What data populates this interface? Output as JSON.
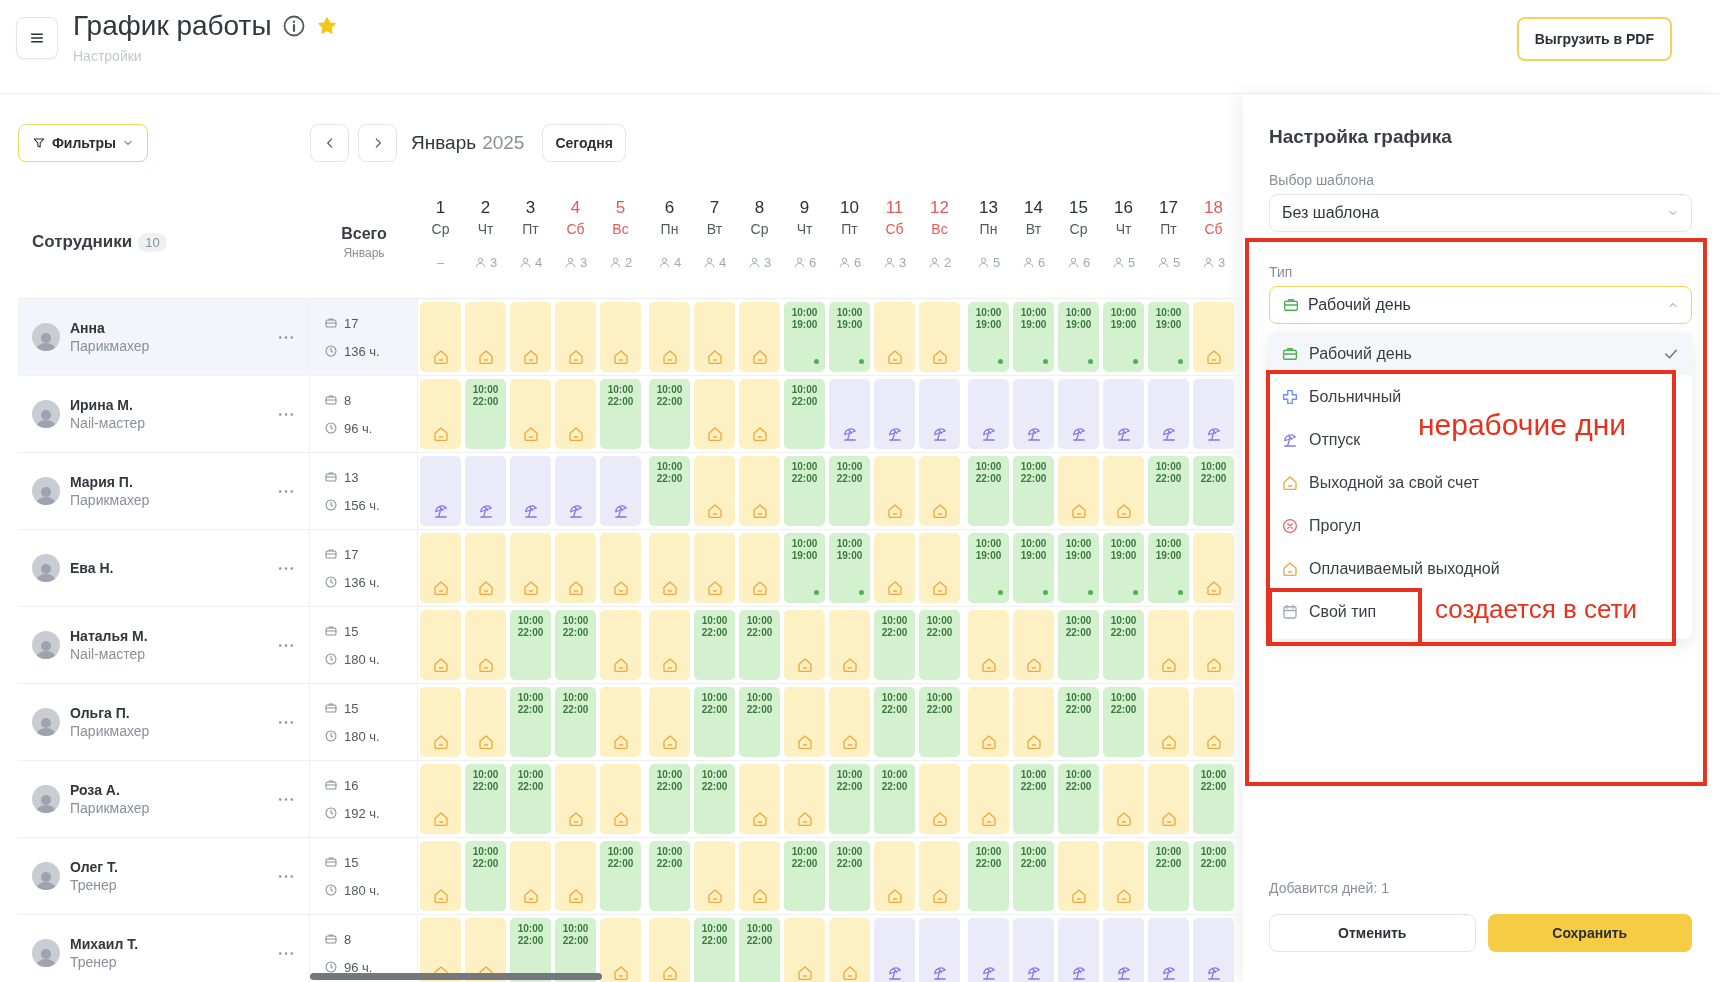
{
  "header": {
    "title": "График работы",
    "subtitle": "Настройки",
    "export_button": "Выгрузить в PDF",
    "favorite": true
  },
  "toolbar": {
    "filters": "Фильтры",
    "month": "Январь",
    "year": "2025",
    "today": "Сегодня"
  },
  "table": {
    "employees_label": "Сотрудники",
    "employees_count": "10",
    "total_label": "Всего",
    "total_sublabel": "Январь",
    "days": [
      {
        "day": "1",
        "weekday": "Ср",
        "weekend": false,
        "staff": "–",
        "staff_icon": false
      },
      {
        "day": "2",
        "weekday": "Чт",
        "weekend": false,
        "staff": "3",
        "staff_icon": true
      },
      {
        "day": "3",
        "weekday": "Пт",
        "weekend": false,
        "staff": "4",
        "staff_icon": true
      },
      {
        "day": "4",
        "weekday": "Сб",
        "weekend": true,
        "staff": "3",
        "staff_icon": true
      },
      {
        "day": "5",
        "weekday": "Вс",
        "weekend": true,
        "staff": "2",
        "staff_icon": true
      },
      {
        "day": "6",
        "weekday": "Пн",
        "weekend": false,
        "staff": "4",
        "staff_icon": true
      },
      {
        "day": "7",
        "weekday": "Вт",
        "weekend": false,
        "staff": "4",
        "staff_icon": true
      },
      {
        "day": "8",
        "weekday": "Ср",
        "weekend": false,
        "staff": "3",
        "staff_icon": true
      },
      {
        "day": "9",
        "weekday": "Чт",
        "weekend": false,
        "staff": "6",
        "staff_icon": true
      },
      {
        "day": "10",
        "weekday": "Пт",
        "weekend": false,
        "staff": "6",
        "staff_icon": true
      },
      {
        "day": "11",
        "weekday": "Сб",
        "weekend": true,
        "staff": "3",
        "staff_icon": true
      },
      {
        "day": "12",
        "weekday": "Вс",
        "weekend": true,
        "staff": "2",
        "staff_icon": true
      },
      {
        "day": "13",
        "weekday": "Пн",
        "weekend": false,
        "staff": "5",
        "staff_icon": true
      },
      {
        "day": "14",
        "weekday": "Вт",
        "weekend": false,
        "staff": "6",
        "staff_icon": true
      },
      {
        "day": "15",
        "weekday": "Ср",
        "weekend": false,
        "staff": "6",
        "staff_icon": true
      },
      {
        "day": "16",
        "weekday": "Чт",
        "weekend": false,
        "staff": "5",
        "staff_icon": true
      },
      {
        "day": "17",
        "weekday": "Пт",
        "weekend": false,
        "staff": "5",
        "staff_icon": true
      },
      {
        "day": "18",
        "weekday": "Сб",
        "weekend": true,
        "staff": "3",
        "staff_icon": true
      }
    ],
    "rows": [
      {
        "name": "Анна",
        "role": "Парикмахер",
        "selected": true,
        "days_count": "17",
        "hours": "136 ч.",
        "cells": [
          {
            "kind": "off"
          },
          {
            "kind": "off"
          },
          {
            "kind": "off"
          },
          {
            "kind": "off"
          },
          {
            "kind": "off"
          },
          {
            "kind": "off"
          },
          {
            "kind": "off"
          },
          {
            "kind": "off"
          },
          {
            "kind": "work",
            "start": "10:00",
            "end": "19:00",
            "dot": true
          },
          {
            "kind": "work",
            "start": "10:00",
            "end": "19:00",
            "dot": true
          },
          {
            "kind": "off"
          },
          {
            "kind": "off"
          },
          {
            "kind": "work",
            "start": "10:00",
            "end": "19:00",
            "dot": true
          },
          {
            "kind": "work",
            "start": "10:00",
            "end": "19:00",
            "dot": true
          },
          {
            "kind": "work",
            "start": "10:00",
            "end": "19:00",
            "dot": true
          },
          {
            "kind": "work",
            "start": "10:00",
            "end": "19:00",
            "dot": true
          },
          {
            "kind": "work",
            "start": "10:00",
            "end": "19:00",
            "dot": true
          },
          {
            "kind": "off"
          }
        ]
      },
      {
        "name": "Ирина М.",
        "role": "Nail-мастер",
        "selected": false,
        "days_count": "8",
        "hours": "96 ч.",
        "cells": [
          {
            "kind": "off"
          },
          {
            "kind": "work",
            "start": "10:00",
            "end": "22:00",
            "dot": false
          },
          {
            "kind": "off"
          },
          {
            "kind": "off"
          },
          {
            "kind": "work",
            "start": "10:00",
            "end": "22:00",
            "dot": false
          },
          {
            "kind": "work",
            "start": "10:00",
            "end": "22:00",
            "dot": false
          },
          {
            "kind": "off"
          },
          {
            "kind": "off"
          },
          {
            "kind": "work",
            "start": "10:00",
            "end": "22:00",
            "dot": false
          },
          {
            "kind": "vacation"
          },
          {
            "kind": "vacation"
          },
          {
            "kind": "vacation"
          },
          {
            "kind": "vacation"
          },
          {
            "kind": "vacation"
          },
          {
            "kind": "vacation"
          },
          {
            "kind": "vacation"
          },
          {
            "kind": "vacation"
          },
          {
            "kind": "vacation"
          }
        ]
      },
      {
        "name": "Мария П.",
        "role": "Парикмахер",
        "selected": false,
        "days_count": "13",
        "hours": "156 ч.",
        "cells": [
          {
            "kind": "vacation"
          },
          {
            "kind": "vacation"
          },
          {
            "kind": "vacation"
          },
          {
            "kind": "vacation"
          },
          {
            "kind": "vacation"
          },
          {
            "kind": "work",
            "start": "10:00",
            "end": "22:00",
            "dot": false
          },
          {
            "kind": "off"
          },
          {
            "kind": "off"
          },
          {
            "kind": "work",
            "start": "10:00",
            "end": "22:00",
            "dot": false
          },
          {
            "kind": "work",
            "start": "10:00",
            "end": "22:00",
            "dot": false
          },
          {
            "kind": "off"
          },
          {
            "kind": "off"
          },
          {
            "kind": "work",
            "start": "10:00",
            "end": "22:00",
            "dot": false
          },
          {
            "kind": "work",
            "start": "10:00",
            "end": "22:00",
            "dot": false
          },
          {
            "kind": "off"
          },
          {
            "kind": "off"
          },
          {
            "kind": "work",
            "start": "10:00",
            "end": "22:00",
            "dot": false
          },
          {
            "kind": "work",
            "start": "10:00",
            "end": "22:00",
            "dot": false
          }
        ]
      },
      {
        "name": "Ева Н.",
        "selected": false,
        "days_count": "17",
        "hours": "136 ч.",
        "cells": [
          {
            "kind": "off"
          },
          {
            "kind": "off"
          },
          {
            "kind": "off"
          },
          {
            "kind": "off"
          },
          {
            "kind": "off"
          },
          {
            "kind": "off"
          },
          {
            "kind": "off"
          },
          {
            "kind": "off"
          },
          {
            "kind": "work",
            "start": "10:00",
            "end": "19:00",
            "dot": true
          },
          {
            "kind": "work",
            "start": "10:00",
            "end": "19:00",
            "dot": true
          },
          {
            "kind": "off"
          },
          {
            "kind": "off"
          },
          {
            "kind": "work",
            "start": "10:00",
            "end": "19:00",
            "dot": true
          },
          {
            "kind": "work",
            "start": "10:00",
            "end": "19:00",
            "dot": true
          },
          {
            "kind": "work",
            "start": "10:00",
            "end": "19:00",
            "dot": true
          },
          {
            "kind": "work",
            "start": "10:00",
            "end": "19:00",
            "dot": true
          },
          {
            "kind": "work",
            "start": "10:00",
            "end": "19:00",
            "dot": true
          },
          {
            "kind": "off"
          }
        ]
      },
      {
        "name": "Наталья М.",
        "role": "Nail-мастер",
        "selected": false,
        "days_count": "15",
        "hours": "180 ч.",
        "cells": [
          {
            "kind": "off"
          },
          {
            "kind": "off"
          },
          {
            "kind": "work",
            "start": "10:00",
            "end": "22:00",
            "dot": false
          },
          {
            "kind": "work",
            "start": "10:00",
            "end": "22:00",
            "dot": false
          },
          {
            "kind": "off"
          },
          {
            "kind": "off"
          },
          {
            "kind": "work",
            "start": "10:00",
            "end": "22:00",
            "dot": false
          },
          {
            "kind": "work",
            "start": "10:00",
            "end": "22:00",
            "dot": false
          },
          {
            "kind": "off"
          },
          {
            "kind": "off"
          },
          {
            "kind": "work",
            "start": "10:00",
            "end": "22:00",
            "dot": false
          },
          {
            "kind": "work",
            "start": "10:00",
            "end": "22:00",
            "dot": false
          },
          {
            "kind": "off"
          },
          {
            "kind": "off"
          },
          {
            "kind": "work",
            "start": "10:00",
            "end": "22:00",
            "dot": false
          },
          {
            "kind": "work",
            "start": "10:00",
            "end": "22:00",
            "dot": false
          },
          {
            "kind": "off"
          },
          {
            "kind": "off"
          }
        ]
      },
      {
        "name": "Ольга П.",
        "role": "Парикмахер",
        "selected": false,
        "days_count": "15",
        "hours": "180 ч.",
        "cells": [
          {
            "kind": "off"
          },
          {
            "kind": "off"
          },
          {
            "kind": "work",
            "start": "10:00",
            "end": "22:00",
            "dot": false
          },
          {
            "kind": "work",
            "start": "10:00",
            "end": "22:00",
            "dot": false
          },
          {
            "kind": "off"
          },
          {
            "kind": "off"
          },
          {
            "kind": "work",
            "start": "10:00",
            "end": "22:00",
            "dot": false
          },
          {
            "kind": "work",
            "start": "10:00",
            "end": "22:00",
            "dot": false
          },
          {
            "kind": "off"
          },
          {
            "kind": "off"
          },
          {
            "kind": "work",
            "start": "10:00",
            "end": "22:00",
            "dot": false
          },
          {
            "kind": "work",
            "start": "10:00",
            "end": "22:00",
            "dot": false
          },
          {
            "kind": "off"
          },
          {
            "kind": "off"
          },
          {
            "kind": "work",
            "start": "10:00",
            "end": "22:00",
            "dot": false
          },
          {
            "kind": "work",
            "start": "10:00",
            "end": "22:00",
            "dot": false
          },
          {
            "kind": "off"
          },
          {
            "kind": "off"
          }
        ]
      },
      {
        "name": "Роза А.",
        "role": "Парикмахер",
        "selected": false,
        "days_count": "16",
        "hours": "192 ч.",
        "cells": [
          {
            "kind": "off"
          },
          {
            "kind": "work",
            "start": "10:00",
            "end": "22:00",
            "dot": false
          },
          {
            "kind": "work",
            "start": "10:00",
            "end": "22:00",
            "dot": false
          },
          {
            "kind": "off"
          },
          {
            "kind": "off"
          },
          {
            "kind": "work",
            "start": "10:00",
            "end": "22:00",
            "dot": false
          },
          {
            "kind": "work",
            "start": "10:00",
            "end": "22:00",
            "dot": false
          },
          {
            "kind": "off"
          },
          {
            "kind": "off"
          },
          {
            "kind": "work",
            "start": "10:00",
            "end": "22:00",
            "dot": false
          },
          {
            "kind": "work",
            "start": "10:00",
            "end": "22:00",
            "dot": false
          },
          {
            "kind": "off"
          },
          {
            "kind": "off"
          },
          {
            "kind": "work",
            "start": "10:00",
            "end": "22:00",
            "dot": false
          },
          {
            "kind": "work",
            "start": "10:00",
            "end": "22:00",
            "dot": false
          },
          {
            "kind": "off"
          },
          {
            "kind": "off"
          },
          {
            "kind": "work",
            "start": "10:00",
            "end": "22:00",
            "dot": false
          }
        ]
      },
      {
        "name": "Олег Т.",
        "role": "Тренер",
        "selected": false,
        "days_count": "15",
        "hours": "180 ч.",
        "cells": [
          {
            "kind": "off"
          },
          {
            "kind": "work",
            "start": "10:00",
            "end": "22:00",
            "dot": false
          },
          {
            "kind": "off"
          },
          {
            "kind": "off"
          },
          {
            "kind": "work",
            "start": "10:00",
            "end": "22:00",
            "dot": false
          },
          {
            "kind": "work",
            "start": "10:00",
            "end": "22:00",
            "dot": false
          },
          {
            "kind": "off"
          },
          {
            "kind": "off"
          },
          {
            "kind": "work",
            "start": "10:00",
            "end": "22:00",
            "dot": false
          },
          {
            "kind": "work",
            "start": "10:00",
            "end": "22:00",
            "dot": false
          },
          {
            "kind": "off"
          },
          {
            "kind": "off"
          },
          {
            "kind": "work",
            "start": "10:00",
            "end": "22:00",
            "dot": false
          },
          {
            "kind": "work",
            "start": "10:00",
            "end": "22:00",
            "dot": false
          },
          {
            "kind": "off"
          },
          {
            "kind": "off"
          },
          {
            "kind": "work",
            "start": "10:00",
            "end": "22:00",
            "dot": false
          },
          {
            "kind": "work",
            "start": "10:00",
            "end": "22:00",
            "dot": false
          }
        ]
      },
      {
        "name": "Михаил Т.",
        "role": "Тренер",
        "selected": false,
        "days_count": "8",
        "hours": "96 ч.",
        "cells": [
          {
            "kind": "off"
          },
          {
            "kind": "off"
          },
          {
            "kind": "work",
            "start": "10:00",
            "end": "22:00"
          },
          {
            "kind": "work",
            "start": "10:00",
            "end": "22:00"
          },
          {
            "kind": "off"
          },
          {
            "kind": "off"
          },
          {
            "kind": "work",
            "start": "10:00",
            "end": "22:00"
          },
          {
            "kind": "work",
            "start": "10:00",
            "end": "22:00"
          },
          {
            "kind": "off"
          },
          {
            "kind": "off"
          },
          {
            "kind": "vacation"
          },
          {
            "kind": "vacation"
          },
          {
            "kind": "vacation"
          },
          {
            "kind": "vacation"
          },
          {
            "kind": "vacation"
          },
          {
            "kind": "vacation"
          },
          {
            "kind": "vacation"
          },
          {
            "kind": "vacation"
          }
        ]
      }
    ]
  },
  "panel": {
    "title": "Настройка графика",
    "template_label": "Выбор шаблона",
    "template_value": "Без шаблона",
    "type_label": "Тип",
    "type_value": "Рабочий день",
    "type_expanded": true,
    "type_options": [
      {
        "label": "Рабочий день",
        "kind": "work",
        "selected": true
      },
      {
        "label": "Больничный",
        "kind": "sick",
        "selected": false
      },
      {
        "label": "Отпуск",
        "kind": "vacation",
        "selected": false
      },
      {
        "label": "Выходной за свой счет",
        "kind": "unpaid",
        "selected": false
      },
      {
        "label": "Прогул",
        "kind": "absence",
        "selected": false
      },
      {
        "label": "Оплачиваемый выходной",
        "kind": "paid",
        "selected": false
      },
      {
        "label": "Свой тип",
        "kind": "custom",
        "selected": false
      }
    ],
    "days_added": "Добавится дней: 1",
    "cancel": "Отменить",
    "save": "Сохранить"
  },
  "annotations": [
    {
      "text": "нерабочие дни"
    },
    {
      "text": "создается в сети"
    }
  ]
}
